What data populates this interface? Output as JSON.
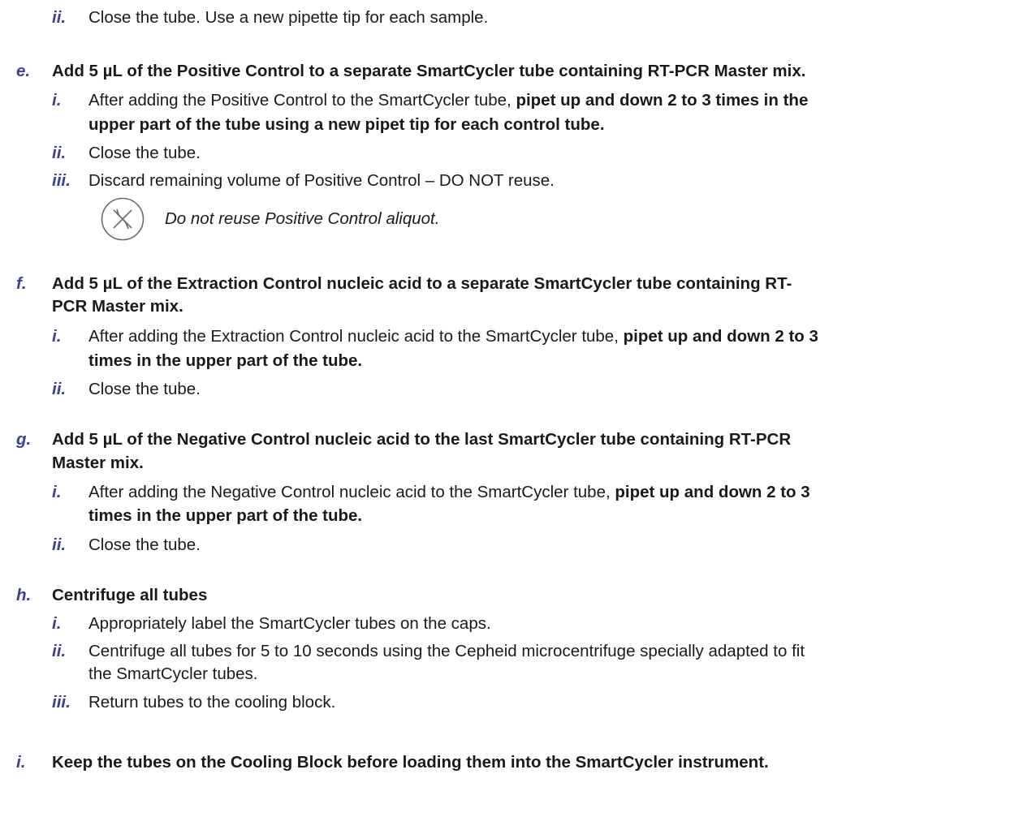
{
  "top": {
    "marker": "ii.",
    "text": "Close the tube. Use a new pipette tip for each sample."
  },
  "step_e": {
    "marker": "e.",
    "text": "Add 5 µL of the Positive Control to a separate SmartCycler tube containing RT-PCR Master mix.",
    "i": {
      "marker": "i.",
      "plain": "After adding the Positive Control to the SmartCycler tube, ",
      "bold1": "pipet up and down 2 to 3 times in the",
      "bold2": "upper part of the tube using a new pipet tip for each control tube."
    },
    "ii": {
      "marker": "ii.",
      "text": "Close the tube."
    },
    "iii": {
      "marker": "iii.",
      "text": "Discard remaining volume of Positive Control – DO NOT reuse."
    },
    "note": {
      "icon": "do-not-reuse-icon",
      "text": "Do not reuse Positive Control aliquot."
    }
  },
  "step_f": {
    "marker": "f.",
    "line1": "Add 5 µL of the Extraction Control nucleic acid to a separate SmartCycler tube containing RT-",
    "line2": "PCR Master mix.",
    "i": {
      "marker": "i.",
      "plain": "After adding the Extraction Control nucleic acid to the SmartCycler tube, ",
      "bold1": "pipet up and down 2 to 3",
      "bold2": "times in the upper part of the tube."
    },
    "ii": {
      "marker": "ii.",
      "text": "Close the tube."
    }
  },
  "step_g": {
    "marker": "g.",
    "line1": "Add 5 µL of the Negative Control nucleic acid to the last SmartCycler tube containing RT-PCR",
    "line2": "Master mix.",
    "i": {
      "marker": "i.",
      "plain": "After adding the Negative Control nucleic acid to the SmartCycler tube, ",
      "bold1": "pipet up and down 2 to 3",
      "bold2": "times in the upper part of the tube."
    },
    "ii": {
      "marker": "ii.",
      "text": "Close the tube."
    }
  },
  "step_h": {
    "marker": "h.",
    "text": "Centrifuge all tubes",
    "i": {
      "marker": "i.",
      "text": "Appropriately label the SmartCycler tubes on the caps."
    },
    "ii": {
      "marker": "ii.",
      "line1": "Centrifuge all tubes for 5 to 10 seconds using the Cepheid microcentrifuge specially adapted to fit",
      "line2": "the SmartCycler tubes."
    },
    "iii": {
      "marker": "iii.",
      "text": "Return tubes to the cooling block."
    }
  },
  "step_i": {
    "marker": "i.",
    "text": "Keep the tubes on the Cooling Block before loading them into the SmartCycler instrument."
  }
}
